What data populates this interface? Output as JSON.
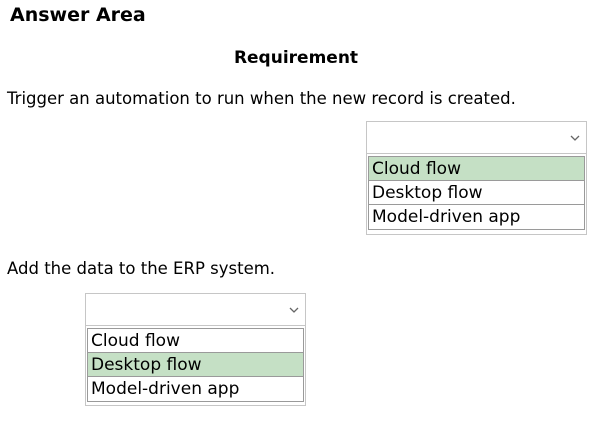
{
  "title": "Answer Area",
  "column_header": "Requirement",
  "requirements": [
    {
      "text": "Trigger an automation to run when the new record is created.",
      "dropdown": {
        "options": [
          "Cloud flow",
          "Desktop flow",
          "Model-driven app"
        ],
        "selected": "Cloud flow"
      }
    },
    {
      "text": "Add the data to the ERP system.",
      "dropdown": {
        "options": [
          "Cloud flow",
          "Desktop flow",
          "Model-driven app"
        ],
        "selected": "Desktop flow"
      }
    }
  ],
  "colors": {
    "selected_highlight": "#c5e0c5",
    "box_border": "#c6c6c6",
    "option_border": "#9a9a9a"
  }
}
